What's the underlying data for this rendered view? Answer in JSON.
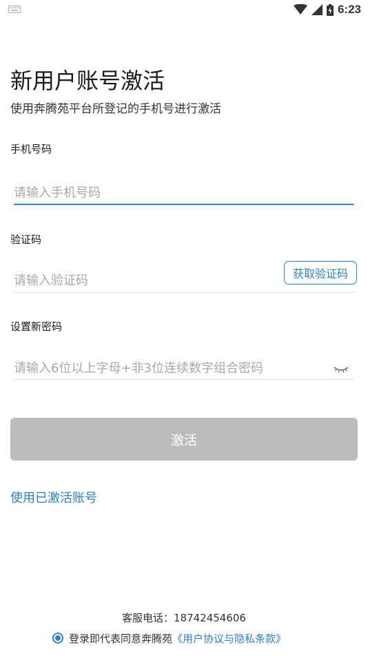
{
  "status_bar": {
    "time": "6:23",
    "icons": [
      "keyboard-icon",
      "wifi-icon",
      "signal-icon",
      "battery-icon"
    ]
  },
  "header": {
    "title": "新用户账号激活",
    "subtitle": "使用奔腾苑平台所登记的手机号进行激活"
  },
  "form": {
    "phone": {
      "label": "手机号码",
      "placeholder": "请输入手机号码",
      "value": ""
    },
    "code": {
      "label": "验证码",
      "placeholder": "请输入验证码",
      "value": "",
      "button_label": "获取验证码"
    },
    "password": {
      "label": "设置新密码",
      "placeholder": "请输入6位以上字母+非3位连续数字组合密码",
      "value": "",
      "toggle_icon": "eye-closed-icon"
    },
    "submit_label": "激活"
  },
  "links": {
    "use_activated": "使用已激活账号"
  },
  "footer": {
    "service_phone": "客服电话：18742454606",
    "agreement_prefix": "登录即代表同意奔腾苑",
    "agreement_link": "《用户协议与隐私条款》",
    "agreement_checked": true
  },
  "colors": {
    "accent": "#2f7fc4",
    "focus_underline": "#2f8bd8",
    "disabled_button": "#bcbdbb"
  }
}
